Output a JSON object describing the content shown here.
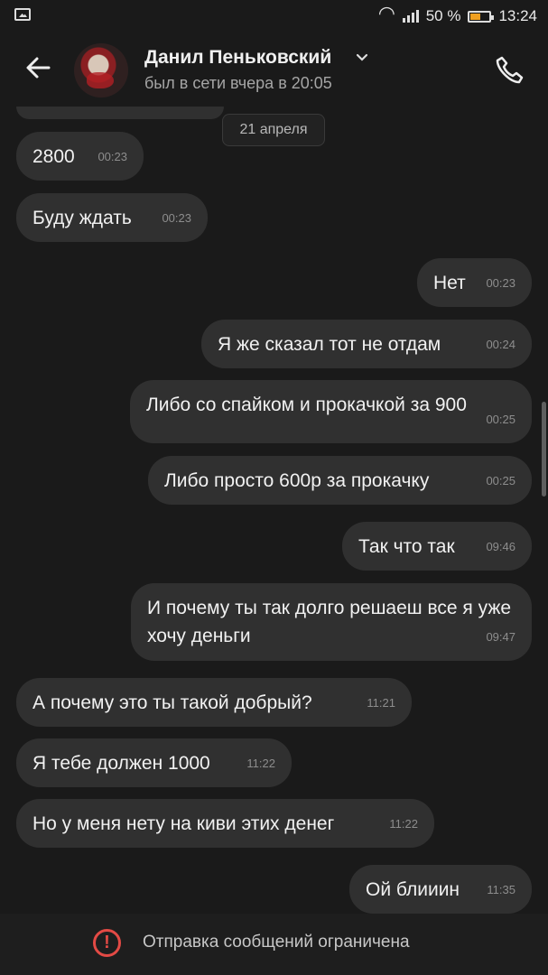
{
  "status": {
    "battery": "50 %",
    "time": "13:24"
  },
  "header": {
    "name": "Данил Пеньковский",
    "status": "был в сети вчера в 20:05"
  },
  "chat": {
    "date": "21 апреля",
    "messages": [
      {
        "text": "2800",
        "time": "00:23",
        "direction": "incoming"
      },
      {
        "text": "Буду ждать",
        "time": "00:23",
        "direction": "incoming"
      },
      {
        "text": "Нет",
        "time": "00:23",
        "direction": "outgoing"
      },
      {
        "text": "Я же сказал тот не отдам",
        "time": "00:24",
        "direction": "outgoing"
      },
      {
        "text": "Либо со спайком и прокачкой за 900",
        "time": "00:25",
        "direction": "outgoing"
      },
      {
        "text": "Либо просто 600р за прокачку",
        "time": "00:25",
        "direction": "outgoing"
      },
      {
        "text": "Так что так",
        "time": "09:46",
        "direction": "outgoing"
      },
      {
        "text": "И почему ты так долго решаеш все я уже хочу деньги",
        "time": "09:47",
        "direction": "outgoing"
      },
      {
        "text": "А почему это ты такой добрый?",
        "time": "11:21",
        "direction": "incoming"
      },
      {
        "text": "Я тебе должен 1000",
        "time": "11:22",
        "direction": "incoming"
      },
      {
        "text": "Но у меня нету на киви этих денег",
        "time": "11:22",
        "direction": "incoming"
      },
      {
        "text": "Ой блииин",
        "time": "11:35",
        "direction": "outgoing"
      }
    ]
  },
  "footer": {
    "notice": "Отправка сообщений ограничена",
    "icon": "warning-icon"
  },
  "colors": {
    "background": "#1a1a1a",
    "bubble": "#303030",
    "warning": "#e34a45",
    "battery": "#f0a020"
  }
}
